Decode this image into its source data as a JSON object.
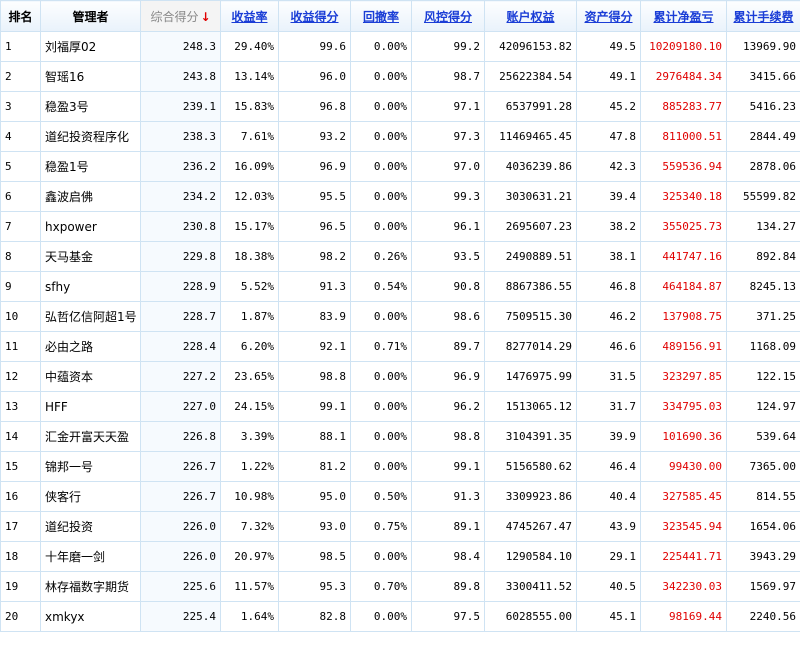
{
  "colors": {
    "link": "#1a3dd6",
    "border": "#cfe3f3",
    "header_bg": "#e9f2fb",
    "profit": "#e00000",
    "sorted_header": "#888888"
  },
  "headers": {
    "rank": "排名",
    "manager": "管理者",
    "score": "综合得分",
    "return_rate": "收益率",
    "return_score": "收益得分",
    "drawdown": "回撤率",
    "risk_score": "风控得分",
    "equity": "账户权益",
    "asset_score": "资产得分",
    "net_profit": "累计净盈亏",
    "fees": "累计手续费"
  },
  "sort": {
    "column": "score",
    "direction": "desc",
    "icon": "arrow-down-icon",
    "glyph": "↓"
  },
  "rows": [
    {
      "rank": "1",
      "manager": "刘福厚02",
      "score": "248.3",
      "return_rate": "29.40%",
      "return_score": "99.6",
      "drawdown": "0.00%",
      "risk_score": "99.2",
      "equity": "42096153.82",
      "asset_score": "49.5",
      "net_profit": "10209180.10",
      "fees": "13969.90"
    },
    {
      "rank": "2",
      "manager": "智瑶16",
      "score": "243.8",
      "return_rate": "13.14%",
      "return_score": "96.0",
      "drawdown": "0.00%",
      "risk_score": "98.7",
      "equity": "25622384.54",
      "asset_score": "49.1",
      "net_profit": "2976484.34",
      "fees": "3415.66"
    },
    {
      "rank": "3",
      "manager": "稳盈3号",
      "score": "239.1",
      "return_rate": "15.83%",
      "return_score": "96.8",
      "drawdown": "0.00%",
      "risk_score": "97.1",
      "equity": "6537991.28",
      "asset_score": "45.2",
      "net_profit": "885283.77",
      "fees": "5416.23"
    },
    {
      "rank": "4",
      "manager": "道纪投资程序化",
      "score": "238.3",
      "return_rate": "7.61%",
      "return_score": "93.2",
      "drawdown": "0.00%",
      "risk_score": "97.3",
      "equity": "11469465.45",
      "asset_score": "47.8",
      "net_profit": "811000.51",
      "fees": "2844.49"
    },
    {
      "rank": "5",
      "manager": "稳盈1号",
      "score": "236.2",
      "return_rate": "16.09%",
      "return_score": "96.9",
      "drawdown": "0.00%",
      "risk_score": "97.0",
      "equity": "4036239.86",
      "asset_score": "42.3",
      "net_profit": "559536.94",
      "fees": "2878.06"
    },
    {
      "rank": "6",
      "manager": "鑫波启佛",
      "score": "234.2",
      "return_rate": "12.03%",
      "return_score": "95.5",
      "drawdown": "0.00%",
      "risk_score": "99.3",
      "equity": "3030631.21",
      "asset_score": "39.4",
      "net_profit": "325340.18",
      "fees": "55599.82"
    },
    {
      "rank": "7",
      "manager": "hxpower",
      "score": "230.8",
      "return_rate": "15.17%",
      "return_score": "96.5",
      "drawdown": "0.00%",
      "risk_score": "96.1",
      "equity": "2695607.23",
      "asset_score": "38.2",
      "net_profit": "355025.73",
      "fees": "134.27"
    },
    {
      "rank": "8",
      "manager": "天马基金",
      "score": "229.8",
      "return_rate": "18.38%",
      "return_score": "98.2",
      "drawdown": "0.26%",
      "risk_score": "93.5",
      "equity": "2490889.51",
      "asset_score": "38.1",
      "net_profit": "441747.16",
      "fees": "892.84"
    },
    {
      "rank": "9",
      "manager": "sfhy",
      "score": "228.9",
      "return_rate": "5.52%",
      "return_score": "91.3",
      "drawdown": "0.54%",
      "risk_score": "90.8",
      "equity": "8867386.55",
      "asset_score": "46.8",
      "net_profit": "464184.87",
      "fees": "8245.13"
    },
    {
      "rank": "10",
      "manager": "弘哲亿信阿超1号",
      "score": "228.7",
      "return_rate": "1.87%",
      "return_score": "83.9",
      "drawdown": "0.00%",
      "risk_score": "98.6",
      "equity": "7509515.30",
      "asset_score": "46.2",
      "net_profit": "137908.75",
      "fees": "371.25"
    },
    {
      "rank": "11",
      "manager": "必由之路",
      "score": "228.4",
      "return_rate": "6.20%",
      "return_score": "92.1",
      "drawdown": "0.71%",
      "risk_score": "89.7",
      "equity": "8277014.29",
      "asset_score": "46.6",
      "net_profit": "489156.91",
      "fees": "1168.09"
    },
    {
      "rank": "12",
      "manager": "中蕴资本",
      "score": "227.2",
      "return_rate": "23.65%",
      "return_score": "98.8",
      "drawdown": "0.00%",
      "risk_score": "96.9",
      "equity": "1476975.99",
      "asset_score": "31.5",
      "net_profit": "323297.85",
      "fees": "122.15"
    },
    {
      "rank": "13",
      "manager": "HFF",
      "score": "227.0",
      "return_rate": "24.15%",
      "return_score": "99.1",
      "drawdown": "0.00%",
      "risk_score": "96.2",
      "equity": "1513065.12",
      "asset_score": "31.7",
      "net_profit": "334795.03",
      "fees": "124.97"
    },
    {
      "rank": "14",
      "manager": "汇金开富天天盈",
      "score": "226.8",
      "return_rate": "3.39%",
      "return_score": "88.1",
      "drawdown": "0.00%",
      "risk_score": "98.8",
      "equity": "3104391.35",
      "asset_score": "39.9",
      "net_profit": "101690.36",
      "fees": "539.64"
    },
    {
      "rank": "15",
      "manager": "锦邦一号",
      "score": "226.7",
      "return_rate": "1.22%",
      "return_score": "81.2",
      "drawdown": "0.00%",
      "risk_score": "99.1",
      "equity": "5156580.62",
      "asset_score": "46.4",
      "net_profit": "99430.00",
      "fees": "7365.00"
    },
    {
      "rank": "16",
      "manager": "侠客行",
      "score": "226.7",
      "return_rate": "10.98%",
      "return_score": "95.0",
      "drawdown": "0.50%",
      "risk_score": "91.3",
      "equity": "3309923.86",
      "asset_score": "40.4",
      "net_profit": "327585.45",
      "fees": "814.55"
    },
    {
      "rank": "17",
      "manager": "道纪投资",
      "score": "226.0",
      "return_rate": "7.32%",
      "return_score": "93.0",
      "drawdown": "0.75%",
      "risk_score": "89.1",
      "equity": "4745267.47",
      "asset_score": "43.9",
      "net_profit": "323545.94",
      "fees": "1654.06"
    },
    {
      "rank": "18",
      "manager": "十年磨一剑",
      "score": "226.0",
      "return_rate": "20.97%",
      "return_score": "98.5",
      "drawdown": "0.00%",
      "risk_score": "98.4",
      "equity": "1290584.10",
      "asset_score": "29.1",
      "net_profit": "225441.71",
      "fees": "3943.29"
    },
    {
      "rank": "19",
      "manager": "林存福数字期货",
      "score": "225.6",
      "return_rate": "11.57%",
      "return_score": "95.3",
      "drawdown": "0.70%",
      "risk_score": "89.8",
      "equity": "3300411.52",
      "asset_score": "40.5",
      "net_profit": "342230.03",
      "fees": "1569.97"
    },
    {
      "rank": "20",
      "manager": "xmkyx",
      "score": "225.4",
      "return_rate": "1.64%",
      "return_score": "82.8",
      "drawdown": "0.00%",
      "risk_score": "97.5",
      "equity": "6028555.00",
      "asset_score": "45.1",
      "net_profit": "98169.44",
      "fees": "2240.56"
    }
  ]
}
